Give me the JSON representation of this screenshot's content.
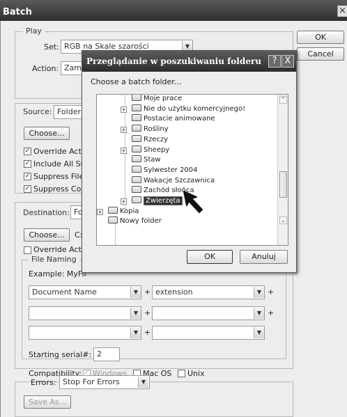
{
  "window": {
    "title": "Batch",
    "close": "×"
  },
  "buttons": {
    "ok": "OK",
    "cancel": "Cancel"
  },
  "play": {
    "legend": "Play",
    "set_label": "Set:",
    "set_value": "RGB na Skale szarości",
    "action_label": "Action:",
    "action_value": "Zamiana"
  },
  "source": {
    "label": "Source:",
    "value": "Folder",
    "choose": "Choose...",
    "checks": [
      {
        "label": "Override Action",
        "checked": true
      },
      {
        "label": "Include All Subfolders",
        "checked": true
      },
      {
        "label": "Suppress File Open",
        "checked": true
      },
      {
        "label": "Suppress Color Profile",
        "checked": true
      }
    ]
  },
  "destination": {
    "label": "Destination:",
    "value": "Folder",
    "choose": "Choose...",
    "path": "C:",
    "override": "Override Action",
    "naming": {
      "legend": "File Naming",
      "example": "Example: MyFile.gif",
      "rows": [
        [
          "Document Name",
          "extension"
        ],
        [
          "",
          ""
        ],
        [
          "",
          ""
        ]
      ],
      "serial_label": "Starting serial#:",
      "serial_value": "2",
      "compat_label": "Compatibility:",
      "windows": "Windows",
      "macos": "Mac OS",
      "unix": "Unix",
      "plus": "+"
    }
  },
  "errors": {
    "label": "Errors:",
    "value": "Stop For Errors",
    "save_as": "Save As..."
  },
  "dialog": {
    "title": "Przeglądanie w poszukiwaniu folderu",
    "help": "?",
    "close": "X",
    "instruction": "Choose a batch folder...",
    "ok": "OK",
    "cancel": "Anuluj",
    "tree": [
      {
        "label": "Moje prace",
        "exp": false
      },
      {
        "label": "Nie do użytku komercyjnego!",
        "exp": true
      },
      {
        "label": "Postacie animowane",
        "exp": false
      },
      {
        "label": "Rośliny",
        "exp": true
      },
      {
        "label": "Rzeczy",
        "exp": false
      },
      {
        "label": "Sheepy",
        "exp": true
      },
      {
        "label": "Staw",
        "exp": false
      },
      {
        "label": "Sylwester 2004",
        "exp": false
      },
      {
        "label": "Wakacje Szczawnica",
        "exp": false
      },
      {
        "label": "Zachód słońca",
        "exp": false
      },
      {
        "label": "Zwierzęta",
        "exp": true,
        "selected": true
      },
      {
        "label": "Kopia",
        "exp": true,
        "parent": true
      },
      {
        "label": "Nowy folder",
        "exp": false,
        "parent": true
      }
    ]
  }
}
